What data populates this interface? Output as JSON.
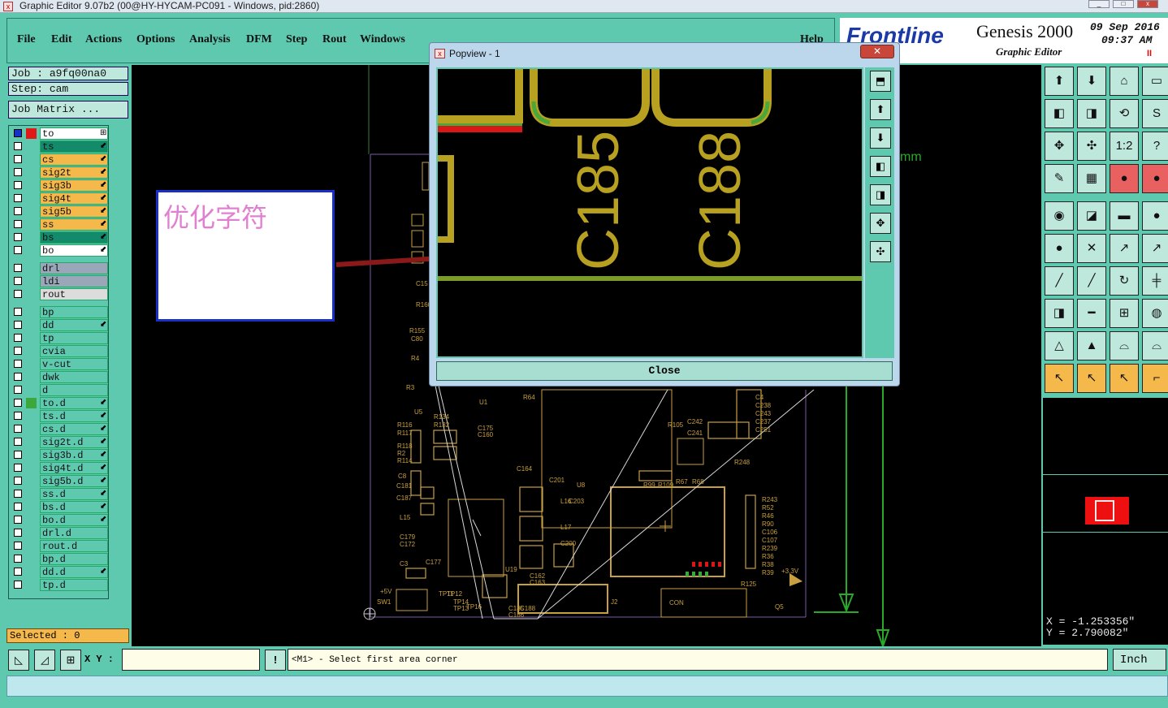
{
  "window": {
    "title": "Graphic Editor 9.07b2 (00@HY-HYCAM-PC091 - Windows, pid:2860)",
    "minimize": "_",
    "maximize": "□",
    "close": "x"
  },
  "menu": {
    "items": [
      "File",
      "Edit",
      "Actions",
      "Options",
      "Analysis",
      "DFM",
      "Step",
      "Rout",
      "Windows"
    ],
    "help": "Help"
  },
  "brand": {
    "logo": "Frontline",
    "product": "Genesis 2000",
    "subtitle": "Graphic Editor",
    "date": "09 Sep 2016",
    "time": "09:37 AM",
    "pause": "II"
  },
  "job": {
    "job_label": "Job : ",
    "job_value": "a9fq00na0",
    "step_label": "Step: ",
    "step_value": "cam",
    "matrix_button": "Job Matrix ..."
  },
  "layers": [
    {
      "name": "to",
      "color": "#ffffff",
      "swatch": "#e01818",
      "mark": "⊞",
      "group": 1
    },
    {
      "name": "ts",
      "color": "#138a6a",
      "swatch": "",
      "mark": "⬋",
      "group": 1
    },
    {
      "name": "cs",
      "color": "#f5b84a",
      "swatch": "",
      "mark": "⬋",
      "group": 1
    },
    {
      "name": "sig2t",
      "color": "#f5b84a",
      "swatch": "",
      "mark": "⬋",
      "group": 1
    },
    {
      "name": "sig3b",
      "color": "#f5b84a",
      "swatch": "",
      "mark": "⬋",
      "group": 1
    },
    {
      "name": "sig4t",
      "color": "#f5b84a",
      "swatch": "",
      "mark": "⬋",
      "group": 1
    },
    {
      "name": "sig5b",
      "color": "#f5b84a",
      "swatch": "",
      "mark": "⬋",
      "group": 1
    },
    {
      "name": "ss",
      "color": "#f5b84a",
      "swatch": "",
      "mark": "⬋",
      "group": 1
    },
    {
      "name": "bs",
      "color": "#138a6a",
      "swatch": "",
      "mark": "⬋",
      "group": 1
    },
    {
      "name": "bo",
      "color": "#ffffff",
      "swatch": "",
      "mark": "⬋",
      "group": 1
    },
    {
      "name": "drl",
      "color": "#9aa7b8",
      "swatch": "",
      "mark": "",
      "group": 2
    },
    {
      "name": "ldi",
      "color": "#9aa7b8",
      "swatch": "",
      "mark": "",
      "group": 2
    },
    {
      "name": "rout",
      "color": "#dcdcdc",
      "swatch": "",
      "mark": "",
      "group": 2
    },
    {
      "name": "bp",
      "color": "#5fc9b0",
      "swatch": "",
      "mark": "",
      "group": 3
    },
    {
      "name": "dd",
      "color": "#5fc9b0",
      "swatch": "",
      "mark": "⬋",
      "group": 3
    },
    {
      "name": "tp",
      "color": "#5fc9b0",
      "swatch": "",
      "mark": "",
      "group": 3
    },
    {
      "name": "cvia",
      "color": "#5fc9b0",
      "swatch": "",
      "mark": "",
      "group": 3
    },
    {
      "name": "v-cut",
      "color": "#5fc9b0",
      "swatch": "",
      "mark": "",
      "group": 3
    },
    {
      "name": "dwk",
      "color": "#5fc9b0",
      "swatch": "",
      "mark": "",
      "group": 3
    },
    {
      "name": "d",
      "color": "#5fc9b0",
      "swatch": "",
      "mark": "",
      "group": 3
    },
    {
      "name": "to.d",
      "color": "#5fc9b0",
      "swatch": "#3aa83a",
      "mark": "⬋",
      "group": 3
    },
    {
      "name": "ts.d",
      "color": "#5fc9b0",
      "swatch": "",
      "mark": "⬋",
      "group": 3
    },
    {
      "name": "cs.d",
      "color": "#5fc9b0",
      "swatch": "",
      "mark": "⬋",
      "group": 3
    },
    {
      "name": "sig2t.d",
      "color": "#5fc9b0",
      "swatch": "",
      "mark": "⬋",
      "group": 3
    },
    {
      "name": "sig3b.d",
      "color": "#5fc9b0",
      "swatch": "",
      "mark": "⬋",
      "group": 3
    },
    {
      "name": "sig4t.d",
      "color": "#5fc9b0",
      "swatch": "",
      "mark": "⬋",
      "group": 3
    },
    {
      "name": "sig5b.d",
      "color": "#5fc9b0",
      "swatch": "",
      "mark": "⬋",
      "group": 3
    },
    {
      "name": "ss.d",
      "color": "#5fc9b0",
      "swatch": "",
      "mark": "⬋",
      "group": 3
    },
    {
      "name": "bs.d",
      "color": "#5fc9b0",
      "swatch": "",
      "mark": "⬋",
      "group": 3
    },
    {
      "name": "bo.d",
      "color": "#5fc9b0",
      "swatch": "",
      "mark": "⬋",
      "group": 3
    },
    {
      "name": "drl.d",
      "color": "#5fc9b0",
      "swatch": "",
      "mark": "",
      "group": 3
    },
    {
      "name": "rout.d",
      "color": "#5fc9b0",
      "swatch": "",
      "mark": "",
      "group": 3
    },
    {
      "name": "bp.d",
      "color": "#5fc9b0",
      "swatch": "",
      "mark": "",
      "group": 3
    },
    {
      "name": "dd.d",
      "color": "#5fc9b0",
      "swatch": "",
      "mark": "⬋",
      "group": 3
    },
    {
      "name": "tp.d",
      "color": "#5fc9b0",
      "swatch": "",
      "mark": "",
      "group": 3
    }
  ],
  "selected": "Selected : 0",
  "popview": {
    "title": "Popview - 1",
    "close_button": "Close",
    "labels": [
      "C185",
      "C188"
    ]
  },
  "annotation": {
    "text": "优化字符"
  },
  "pcb_labels": [
    "C4",
    "C238",
    "C243",
    "C237",
    "C251",
    "C242",
    "C241",
    "R105",
    "R248",
    "R243",
    "R52",
    "R46",
    "R90",
    "C106",
    "C107",
    "R239",
    "R36",
    "R38",
    "R39",
    "R125",
    "+3.3V",
    "Q5",
    "J2",
    "CON",
    "U19",
    "SW1",
    "+5V",
    "R99",
    "R109",
    "R67",
    "R68",
    "C201",
    "U8",
    "L16",
    "L17",
    "C203",
    "C200",
    "R134",
    "R132",
    "C175",
    "C160",
    "R116",
    "R117",
    "R118",
    "R2",
    "R114",
    "C8",
    "C181",
    "C187",
    "L15",
    "C179",
    "C172",
    "C3",
    "C177",
    "TP11",
    "TP12",
    "TP14",
    "TP13",
    "TP16",
    "C185",
    "C186",
    "C188",
    "C162",
    "C163",
    "C164",
    "R155",
    "C80",
    "R4",
    "C15",
    "R160",
    "R3",
    "U5",
    "U1",
    "R64",
    "mm"
  ],
  "coords": {
    "x": "X = -1.253356\"",
    "y": "Y = 2.790082\""
  },
  "bottom": {
    "xy_label": "X Y :",
    "xy_value": "",
    "excl": "!",
    "prompt": "<M1> - Select first area corner",
    "unit": "Inch"
  },
  "toolbar_icons": [
    "layer-up-icon",
    "layer-down-icon",
    "home-icon",
    "window-icon",
    "pan-left-icon",
    "pan-right-icon",
    "zoom-back-icon",
    "snap-icon",
    "zoom-fit-icon",
    "zoom-center-icon",
    "scale-1-2-icon",
    "help-icon",
    "tool-icon",
    "grid-icon",
    "net-icon",
    "net-alt-icon",
    "pad-icon",
    "route-icon",
    "ruler-icon",
    "circle-icon",
    "node-icon",
    "cross-icon",
    "arrow-node-icon",
    "arrow-node2-icon",
    "line-icon",
    "diag-line-icon",
    "arc-icon",
    "split-icon",
    "pad-arrow-icon",
    "minus-icon",
    "box-link-icon",
    "shape-icon",
    "triangle-icon",
    "triangle2-icon",
    "arch-icon",
    "arch2-icon",
    "select-icon",
    "select2-icon",
    "select3-icon",
    "route-select-icon"
  ],
  "toolbar_glyphs": [
    "⬆",
    "⬇",
    "⌂",
    "▭",
    "◧",
    "◨",
    "⟲",
    "S",
    "✥",
    "✣",
    "1:2",
    "?",
    "✎",
    "▦",
    "●",
    "●",
    "◉",
    "◪",
    "▬",
    "●",
    "●",
    "✕",
    "↗",
    "↗",
    "╱",
    "╱",
    "↻",
    "╪",
    "◨",
    "━",
    "⊞",
    "◍",
    "△",
    "▲",
    "⌓",
    "⌓",
    "↖",
    "↖",
    "↖",
    "⌐"
  ],
  "pop_tools": [
    "⬒",
    "⬆",
    "⬇",
    "◧",
    "◨",
    "✥",
    "✣"
  ],
  "bottom_icons": [
    "◺",
    "◿",
    "⊞"
  ]
}
